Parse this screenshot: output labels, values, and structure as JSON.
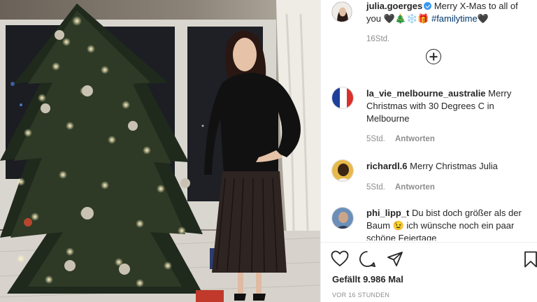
{
  "post": {
    "author": "julia.goerges",
    "caption_text": "Merry X-Mas to all of you",
    "caption_emojis": "🖤🎄❄️🎁",
    "hashtag": "#familytime",
    "hashtag_emoji": "🖤",
    "age": "16Std."
  },
  "comments": [
    {
      "user": "la_vie_melbourne_australie",
      "text": "Merry Christmas with 30 Degrees C in Melbourne",
      "age": "5Std.",
      "reply_label": "Antworten"
    },
    {
      "user": "richardl.6",
      "text": "Merry Christmas Julia",
      "age": "5Std.",
      "reply_label": "Antworten"
    },
    {
      "user": "phi_lipp_t",
      "text": "Du bist doch größer als der Baum 😉 ich wünsche noch ein paar schöne Feiertage",
      "age": "",
      "reply_label": ""
    }
  ],
  "footer": {
    "likes": "Gefällt 9.986 Mal",
    "timestamp": "VOR 16 STUNDEN"
  },
  "icons": {
    "like": "heart-icon",
    "comment": "comment-icon",
    "share": "share-icon",
    "save": "bookmark-icon",
    "load_more": "plus-circle-icon",
    "verified": "verified-badge-icon"
  },
  "colors": {
    "text": "#262626",
    "muted": "#8e8e8e",
    "hashtag": "#00376b",
    "verified": "#3897f0"
  }
}
